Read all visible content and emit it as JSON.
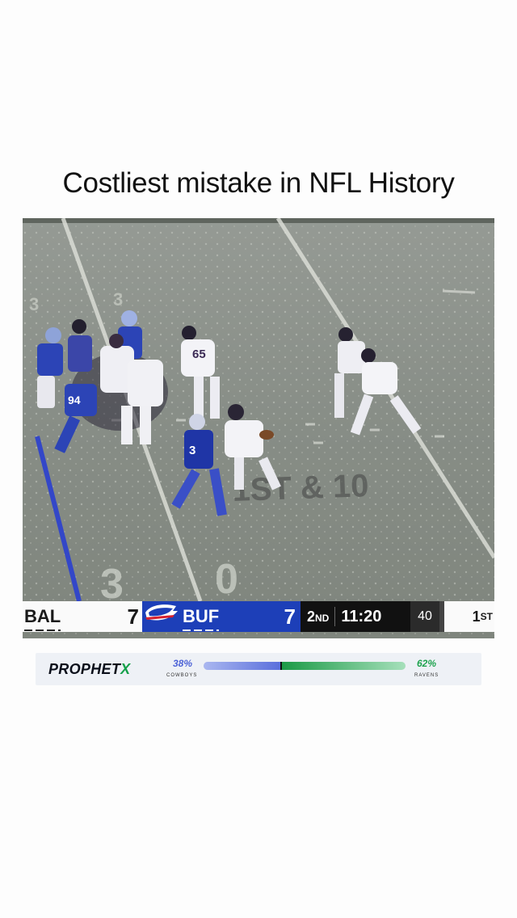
{
  "caption": "Costliest mistake in NFL History",
  "field": {
    "down_marker": "1ST & 10",
    "yard_number_top": "3",
    "yard_number_bottom_left": "3",
    "yard_number_bottom_right": "0",
    "jerseys": [
      "65",
      "94",
      "3"
    ]
  },
  "scorebug": {
    "away_team": "BAL",
    "away_score": "7",
    "home_team": "BUF",
    "home_score": "7",
    "quarter_num": "2",
    "quarter_suffix": "ND",
    "clock": "11:20",
    "play_clock": "40",
    "down_num": "1",
    "down_suffix": "ST",
    "colors": {
      "home_blue": "#1d3fb8",
      "clock_bg": "#111111"
    }
  },
  "prophetx": {
    "brand_main": "PROPHET",
    "brand_x": "X",
    "left_pct": "38%",
    "left_label": "COWBOYS",
    "right_pct": "62%",
    "right_label": "RAVENS",
    "left_value": 0.38,
    "colors": {
      "left": "#5a6fdc",
      "right": "#1c9a47"
    }
  }
}
